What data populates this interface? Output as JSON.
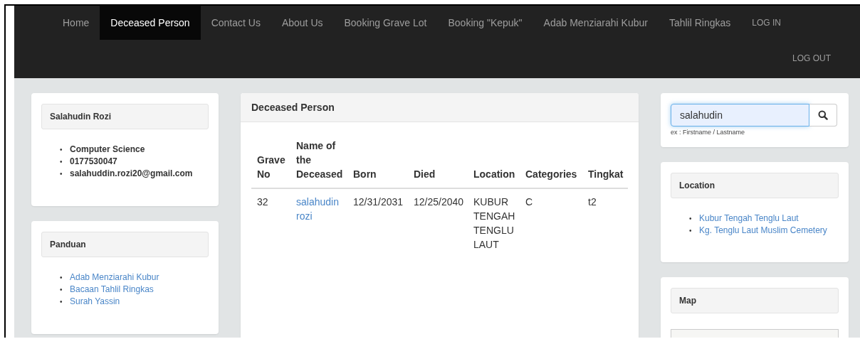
{
  "nav": {
    "items": [
      {
        "label": "Home",
        "kind": "page",
        "selected": false
      },
      {
        "label": "Deceased Person",
        "kind": "page",
        "selected": true
      },
      {
        "label": "Contact Us",
        "kind": "page",
        "selected": false
      },
      {
        "label": "About Us",
        "kind": "page",
        "selected": false
      },
      {
        "label": "Booking Grave Lot",
        "kind": "page",
        "selected": false
      },
      {
        "label": "Booking \"Kepuk\"",
        "kind": "page",
        "selected": false
      },
      {
        "label": "Adab Menziarahi Kubur",
        "kind": "page",
        "selected": false
      },
      {
        "label": "Tahlil Ringkas",
        "kind": "page",
        "selected": false
      },
      {
        "label": "LOG IN",
        "kind": "auth",
        "selected": false
      }
    ],
    "right_items": [
      {
        "label": "LOG OUT",
        "kind": "auth",
        "selected": false
      }
    ]
  },
  "profile": {
    "title": "Salahudin Rozi",
    "marker": "•",
    "details": [
      "Computer Science",
      "0177530047",
      "salahuddin.rozi20@gmail.com"
    ]
  },
  "guide": {
    "title": "Panduan",
    "marker": "•",
    "links": [
      "Adab Menziarahi Kubur",
      "Bacaan Tahlil Ringkas",
      "Surah Yassin"
    ]
  },
  "main_panel": {
    "title": "Deceased Person",
    "table": {
      "columns": [
        {
          "label": "Grave No",
          "kind": "text"
        },
        {
          "label": "Name of the Deceased",
          "kind": "link"
        },
        {
          "label": "Born",
          "kind": "text"
        },
        {
          "label": "Died",
          "kind": "text"
        },
        {
          "label": "Location",
          "kind": "text"
        },
        {
          "label": "Categories",
          "kind": "text"
        },
        {
          "label": "Tingkat",
          "kind": "text"
        }
      ],
      "rows": [
        [
          "32",
          "salahudin rozi",
          "12/31/2031",
          "12/25/2040",
          "KUBUR TENGAH TENGLU LAUT",
          "C",
          "t2"
        ]
      ]
    }
  },
  "search": {
    "value": "salahudin",
    "focused": true,
    "hint": "ex : Firstname / Lastname"
  },
  "locations": {
    "title": "Location",
    "marker": "•",
    "links": [
      "Kubur Tengah Tenglu Laut",
      "Kg. Tenglu Laut Muslim Cemetery"
    ]
  },
  "map": {
    "title": "Map"
  }
}
